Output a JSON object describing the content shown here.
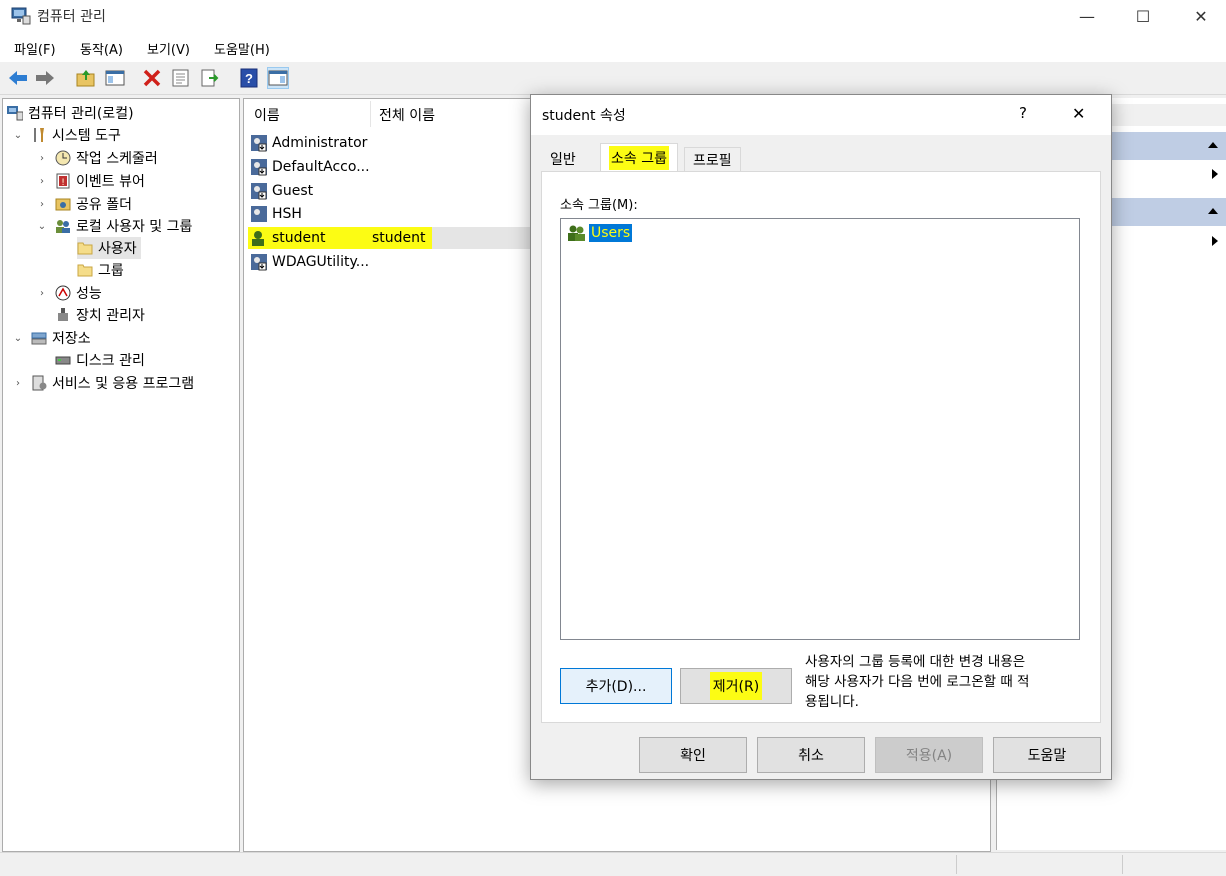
{
  "window": {
    "title": "컴퓨터 관리",
    "minimize": "—",
    "maximize": "☐",
    "close": "✕"
  },
  "menu": [
    "파일(F)",
    "동작(A)",
    "보기(V)",
    "도움말(H)"
  ],
  "toolbar_icons": [
    "back-icon",
    "forward-icon",
    "up-folder-icon",
    "show-hide-tree-icon",
    "delete-icon",
    "properties-icon",
    "export-icon",
    "help-icon",
    "show-hide-action-icon"
  ],
  "tree": {
    "root": "컴퓨터 관리(로컬)",
    "system_tools": "시스템 도구",
    "task_scheduler": "작업 스케줄러",
    "event_viewer": "이벤트 뷰어",
    "shared_folders": "공유 폴더",
    "local_users_groups": "로컬 사용자 및 그룹",
    "users": "사용자",
    "groups": "그룹",
    "performance": "성능",
    "device_manager": "장치 관리자",
    "storage": "저장소",
    "disk_management": "디스크 관리",
    "services_apps": "서비스 및 응용 프로그램"
  },
  "list": {
    "columns": [
      "이름",
      "전체 이름"
    ],
    "rows": [
      {
        "name": "Administrator",
        "full": ""
      },
      {
        "name": "DefaultAcco...",
        "full": ""
      },
      {
        "name": "Guest",
        "full": ""
      },
      {
        "name": "HSH",
        "full": ""
      },
      {
        "name": "student",
        "full": "student"
      },
      {
        "name": "WDAGUtility...",
        "full": ""
      }
    ]
  },
  "dialog": {
    "title": "student 속성",
    "help": "?",
    "close": "✕",
    "tabs": [
      "일반",
      "소속 그룹",
      "프로필"
    ],
    "member_of_label": "소속 그룹(M):",
    "groups": [
      "Users"
    ],
    "add_button": "추가(D)...",
    "remove_button": "제거(R)",
    "note_line1": "사용자의 그룹 등록에 대한 변경 내용은",
    "note_line2": "해당 사용자가 다음 번에 로그온할 때 적",
    "note_line3": "용됩니다.",
    "ok": "확인",
    "cancel": "취소",
    "apply": "적용(A)",
    "help_button": "도움말"
  },
  "colors": {
    "highlight": "#fcfc14",
    "selection": "#0078d7",
    "action_band": "#bfcde4"
  }
}
